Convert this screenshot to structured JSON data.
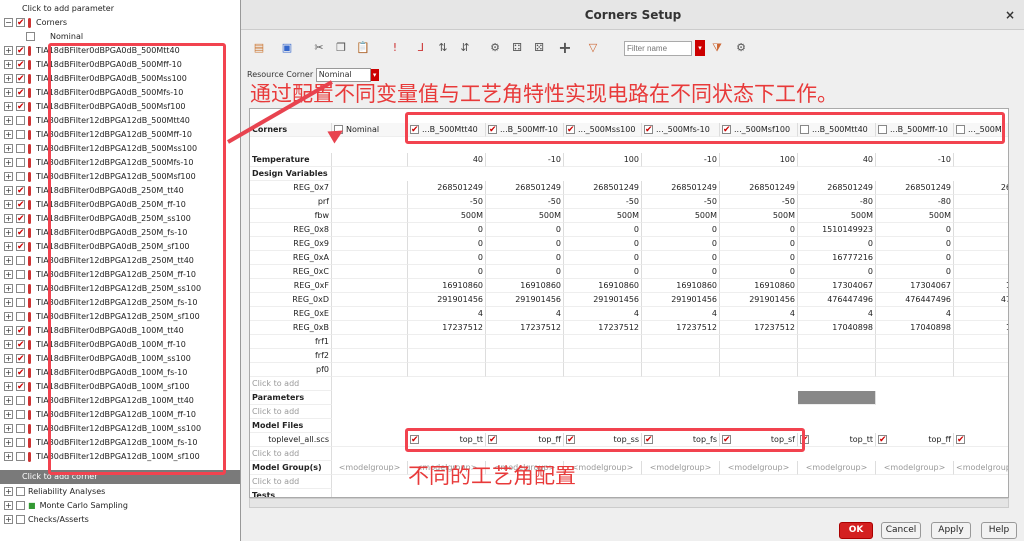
{
  "tree": {
    "top_hint": "Click to add parameter",
    "corners_label": "Corners",
    "nominal_label": "Nominal",
    "items": [
      {
        "name": "TIA18dBFilter0dBPGA0dB_500Mtt40",
        "checked": true
      },
      {
        "name": "TIA18dBFilter0dBPGA0dB_500Mff-10",
        "checked": true
      },
      {
        "name": "TIA18dBFilter0dBPGA0dB_500Mss100",
        "checked": true
      },
      {
        "name": "TIA18dBFilter0dBPGA0dB_500Mfs-10",
        "checked": true
      },
      {
        "name": "TIA18dBFilter0dBPGA0dB_500Msf100",
        "checked": true
      },
      {
        "name": "TIA30dBFilter12dBPGA12dB_500Mtt40",
        "checked": false
      },
      {
        "name": "TIA30dBFilter12dBPGA12dB_500Mff-10",
        "checked": false
      },
      {
        "name": "TIA30dBFilter12dBPGA12dB_500Mss100",
        "checked": false
      },
      {
        "name": "TIA30dBFilter12dBPGA12dB_500Mfs-10",
        "checked": false
      },
      {
        "name": "TIA30dBFilter12dBPGA12dB_500Msf100",
        "checked": false
      },
      {
        "name": "TIA18dBFilter0dBPGA0dB_250M_tt40",
        "checked": true
      },
      {
        "name": "TIA18dBFilter0dBPGA0dB_250M_ff-10",
        "checked": true
      },
      {
        "name": "TIA18dBFilter0dBPGA0dB_250M_ss100",
        "checked": true
      },
      {
        "name": "TIA18dBFilter0dBPGA0dB_250M_fs-10",
        "checked": true
      },
      {
        "name": "TIA18dBFilter0dBPGA0dB_250M_sf100",
        "checked": true
      },
      {
        "name": "TIA30dBFilter12dBPGA12dB_250M_tt40",
        "checked": false
      },
      {
        "name": "TIA30dBFilter12dBPGA12dB_250M_ff-10",
        "checked": false
      },
      {
        "name": "TIA30dBFilter12dBPGA12dB_250M_ss100",
        "checked": false
      },
      {
        "name": "TIA30dBFilter12dBPGA12dB_250M_fs-10",
        "checked": false
      },
      {
        "name": "TIA30dBFilter12dBPGA12dB_250M_sf100",
        "checked": false
      },
      {
        "name": "TIA18dBFilter0dBPGA0dB_100M_tt40",
        "checked": true
      },
      {
        "name": "TIA18dBFilter0dBPGA0dB_100M_ff-10",
        "checked": true
      },
      {
        "name": "TIA18dBFilter0dBPGA0dB_100M_ss100",
        "checked": true
      },
      {
        "name": "TIA18dBFilter0dBPGA0dB_100M_fs-10",
        "checked": true
      },
      {
        "name": "TIA18dBFilter0dBPGA0dB_100M_sf100",
        "checked": true
      },
      {
        "name": "TIA30dBFilter12dBPGA12dB_100M_tt40",
        "checked": false
      },
      {
        "name": "TIA30dBFilter12dBPGA12dB_100M_ff-10",
        "checked": false
      },
      {
        "name": "TIA30dBFilter12dBPGA12dB_100M_ss100",
        "checked": false
      },
      {
        "name": "TIA30dBFilter12dBPGA12dB_100M_fs-10",
        "checked": false
      },
      {
        "name": "TIA30dBFilter12dBPGA12dB_100M_sf100",
        "checked": false
      }
    ],
    "click_to_add_corner": "Click to add corner",
    "reliability": "Reliability Analyses",
    "monte_carlo": "Monte Carlo Sampling",
    "checks": "Checks/Asserts"
  },
  "dialog": {
    "title": "Corners Setup",
    "close": "×",
    "filter_placeholder": "Filter name",
    "resource_corner_label": "Resource Corner",
    "resource_corner_value": "Nominal",
    "annotation_top": "通过配置不同变量值与工艺角特性实现电路在不同状态下工作。",
    "annotation_bottom": "不同的工艺角配置",
    "grid": {
      "corners_label": "Corners",
      "columns": [
        "Nominal",
        "...B_500Mtt40",
        "...B_500Mff-10",
        "..._500Mss100",
        "..._500Mfs-10",
        "..._500Msf100",
        "...B_500Mtt40",
        "...B_500Mff-10",
        "..._500M"
      ],
      "temperature_label": "Temperature",
      "temperature": [
        "",
        "40",
        "-10",
        "100",
        "-10",
        "100",
        "40",
        "-10",
        ""
      ],
      "design_vars_label": "Design Variables",
      "vars": [
        {
          "name": "REG_0x7",
          "vals": [
            "",
            "268501249",
            "268501249",
            "268501249",
            "268501249",
            "268501249",
            "268501249",
            "268501249",
            "26"
          ]
        },
        {
          "name": "prf",
          "vals": [
            "",
            "-50",
            "-50",
            "-50",
            "-50",
            "-50",
            "-80",
            "-80",
            ""
          ]
        },
        {
          "name": "fbw",
          "vals": [
            "",
            "500M",
            "500M",
            "500M",
            "500M",
            "500M",
            "500M",
            "500M",
            ""
          ]
        },
        {
          "name": "REG_0x8",
          "vals": [
            "",
            "0",
            "0",
            "0",
            "0",
            "0",
            "1510149923",
            "0",
            ""
          ]
        },
        {
          "name": "REG_0x9",
          "vals": [
            "",
            "0",
            "0",
            "0",
            "0",
            "0",
            "0",
            "0",
            ""
          ]
        },
        {
          "name": "REG_0xA",
          "vals": [
            "",
            "0",
            "0",
            "0",
            "0",
            "0",
            "16777216",
            "0",
            ""
          ]
        },
        {
          "name": "REG_0xC",
          "vals": [
            "",
            "0",
            "0",
            "0",
            "0",
            "0",
            "0",
            "0",
            ""
          ]
        },
        {
          "name": "REG_0xF",
          "vals": [
            "",
            "16910860",
            "16910860",
            "16910860",
            "16910860",
            "16910860",
            "17304067",
            "17304067",
            "1"
          ]
        },
        {
          "name": "REG_0xD",
          "vals": [
            "",
            "291901456",
            "291901456",
            "291901456",
            "291901456",
            "291901456",
            "476447496",
            "476447496",
            "47"
          ]
        },
        {
          "name": "REG_0xE",
          "vals": [
            "",
            "4",
            "4",
            "4",
            "4",
            "4",
            "4",
            "4",
            ""
          ]
        },
        {
          "name": "REG_0xB",
          "vals": [
            "",
            "17237512",
            "17237512",
            "17237512",
            "17237512",
            "17237512",
            "17040898",
            "17040898",
            "1"
          ]
        },
        {
          "name": "frf1",
          "vals": [
            "",
            "",
            "",
            "",
            "",
            "",
            "",
            "",
            ""
          ]
        },
        {
          "name": "frf2",
          "vals": [
            "",
            "",
            "",
            "",
            "",
            "",
            "",
            "",
            ""
          ]
        },
        {
          "name": "pf0",
          "vals": [
            "",
            "",
            "",
            "",
            "",
            "",
            "",
            "",
            ""
          ]
        }
      ],
      "click_to_add": "Click to add",
      "parameters_label": "Parameters",
      "model_files_label": "Model Files",
      "model_file_name": "toplevel_all.scs",
      "model_sections": [
        "",
        "top_tt",
        "top_ff",
        "top_ss",
        "top_fs",
        "top_sf",
        "top_tt",
        "top_ff",
        ""
      ],
      "model_groups_label": "Model Group(s)",
      "modelgroup_placeholder": "<modelgroup>",
      "tests_label": "Tests"
    },
    "buttons": {
      "ok": "OK",
      "cancel": "Cancel",
      "apply": "Apply",
      "help": "Help"
    }
  }
}
